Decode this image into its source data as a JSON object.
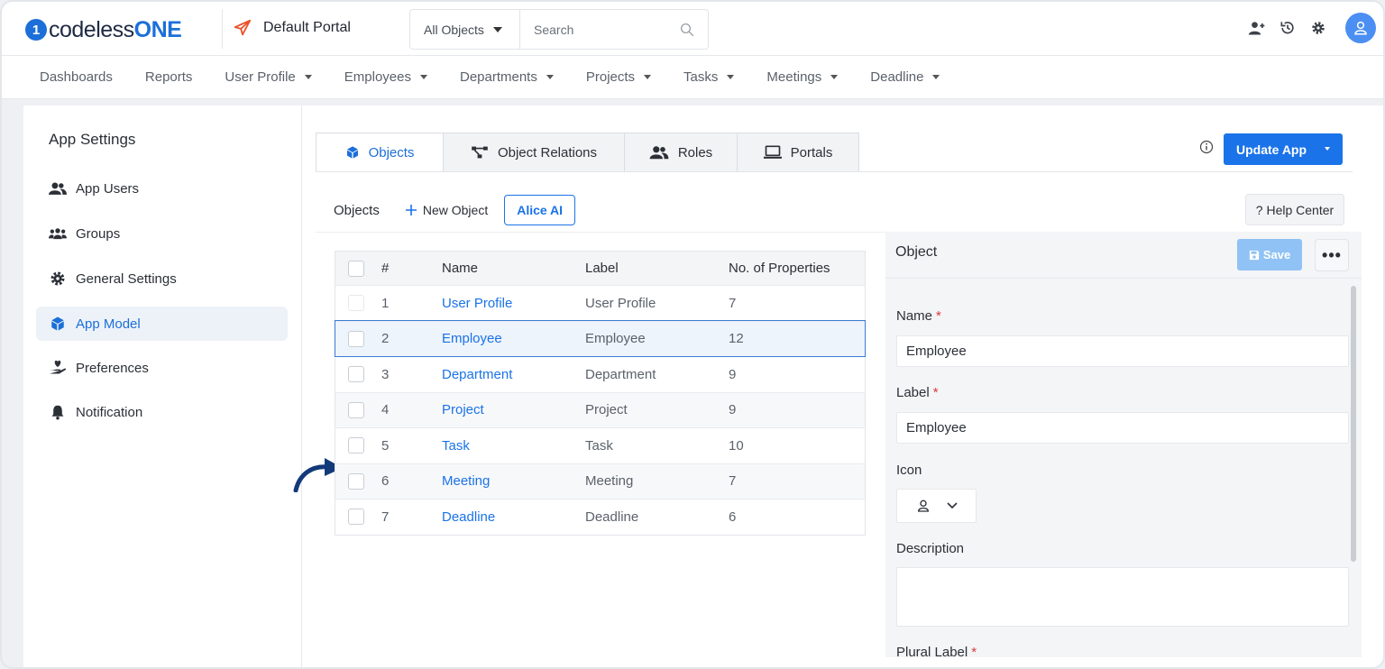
{
  "header": {
    "logo_mark": "1",
    "logo_text_a": "codeless",
    "logo_text_b": "ONE",
    "portal_name": "Default Portal",
    "search_scope": "All Objects",
    "search_placeholder": "Search"
  },
  "nav": [
    "Dashboards",
    "Reports",
    "User Profile",
    "Employees",
    "Departments",
    "Projects",
    "Tasks",
    "Meetings",
    "Deadline"
  ],
  "sidebar": {
    "title": "App Settings",
    "items": [
      {
        "label": "App Users",
        "icon": "users-icon"
      },
      {
        "label": "Groups",
        "icon": "groups-icon"
      },
      {
        "label": "General Settings",
        "icon": "gear-icon"
      },
      {
        "label": "App Model",
        "icon": "cube-icon",
        "active": true
      },
      {
        "label": "Preferences",
        "icon": "hand-heart-icon"
      },
      {
        "label": "Notification",
        "icon": "bell-icon"
      }
    ]
  },
  "tabs": [
    {
      "label": "Objects",
      "icon": "cube-icon"
    },
    {
      "label": "Object Relations",
      "icon": "relations-icon"
    },
    {
      "label": "Roles",
      "icon": "users-icon"
    },
    {
      "label": "Portals",
      "icon": "laptop-icon"
    }
  ],
  "actions": {
    "update_app": "Update App",
    "objects_label": "Objects",
    "new_object": "New Object",
    "alice_ai": "Alice AI",
    "help_center": "? Help Center"
  },
  "table": {
    "headers": {
      "num": "#",
      "name": "Name",
      "label": "Label",
      "props": "No. of Properties"
    },
    "rows": [
      {
        "num": "1",
        "name": "User Profile",
        "label": "User Profile",
        "props": "7"
      },
      {
        "num": "2",
        "name": "Employee",
        "label": "Employee",
        "props": "12"
      },
      {
        "num": "3",
        "name": "Department",
        "label": "Department",
        "props": "9"
      },
      {
        "num": "4",
        "name": "Project",
        "label": "Project",
        "props": "9"
      },
      {
        "num": "5",
        "name": "Task",
        "label": "Task",
        "props": "10"
      },
      {
        "num": "6",
        "name": "Meeting",
        "label": "Meeting",
        "props": "7"
      },
      {
        "num": "7",
        "name": "Deadline",
        "label": "Deadline",
        "props": "6"
      }
    ]
  },
  "panel": {
    "title": "Object",
    "save": "Save",
    "more": "•••",
    "name_label": "Name",
    "name_value": "Employee",
    "label_label": "Label",
    "label_value": "Employee",
    "icon_label": "Icon",
    "description_label": "Description",
    "plural_label": "Plural Label",
    "required_mark": "*"
  },
  "colors": {
    "accent": "#1a73e8",
    "brand": "#1c6fd8",
    "portal_icon": "#e8532a",
    "required": "#d93a3a"
  }
}
